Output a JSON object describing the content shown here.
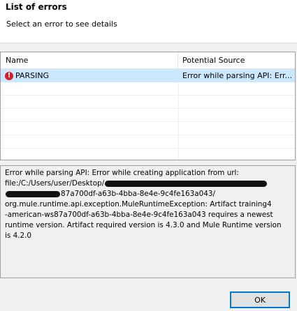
{
  "header": {
    "title": "List of errors",
    "description": "Select an error to see details"
  },
  "table": {
    "columns": [
      "Name",
      "Potential Source"
    ],
    "rows": [
      {
        "name": "PARSING",
        "source": "Error while parsing API: Err...",
        "icon": "error-icon",
        "selected": true
      }
    ],
    "empty_row_count": 6
  },
  "details": {
    "line1": "Error while parsing API: Error while creating application from url:",
    "line2_prefix": "file:/C:/Users/user/Desktop/",
    "line3_suffix": "87a700df-a63b-4bba-8e4e-9c4fe163a043/",
    "line4": "org.mule.runtime.api.exception.MuleRuntimeException: Artifact training4",
    "line5": "-american-ws87a700df-a63b-4bba-8e4e-9c4fe163a043 requires a newest",
    "line6": "runtime version. Artifact required version is 4.3.0 and Mule Runtime version",
    "line7": "is 4.2.0"
  },
  "footer": {
    "ok_label": "OK"
  },
  "colors": {
    "selection": "#cce8ff",
    "error_icon": "#d2232a",
    "button_border": "#0078d7"
  }
}
